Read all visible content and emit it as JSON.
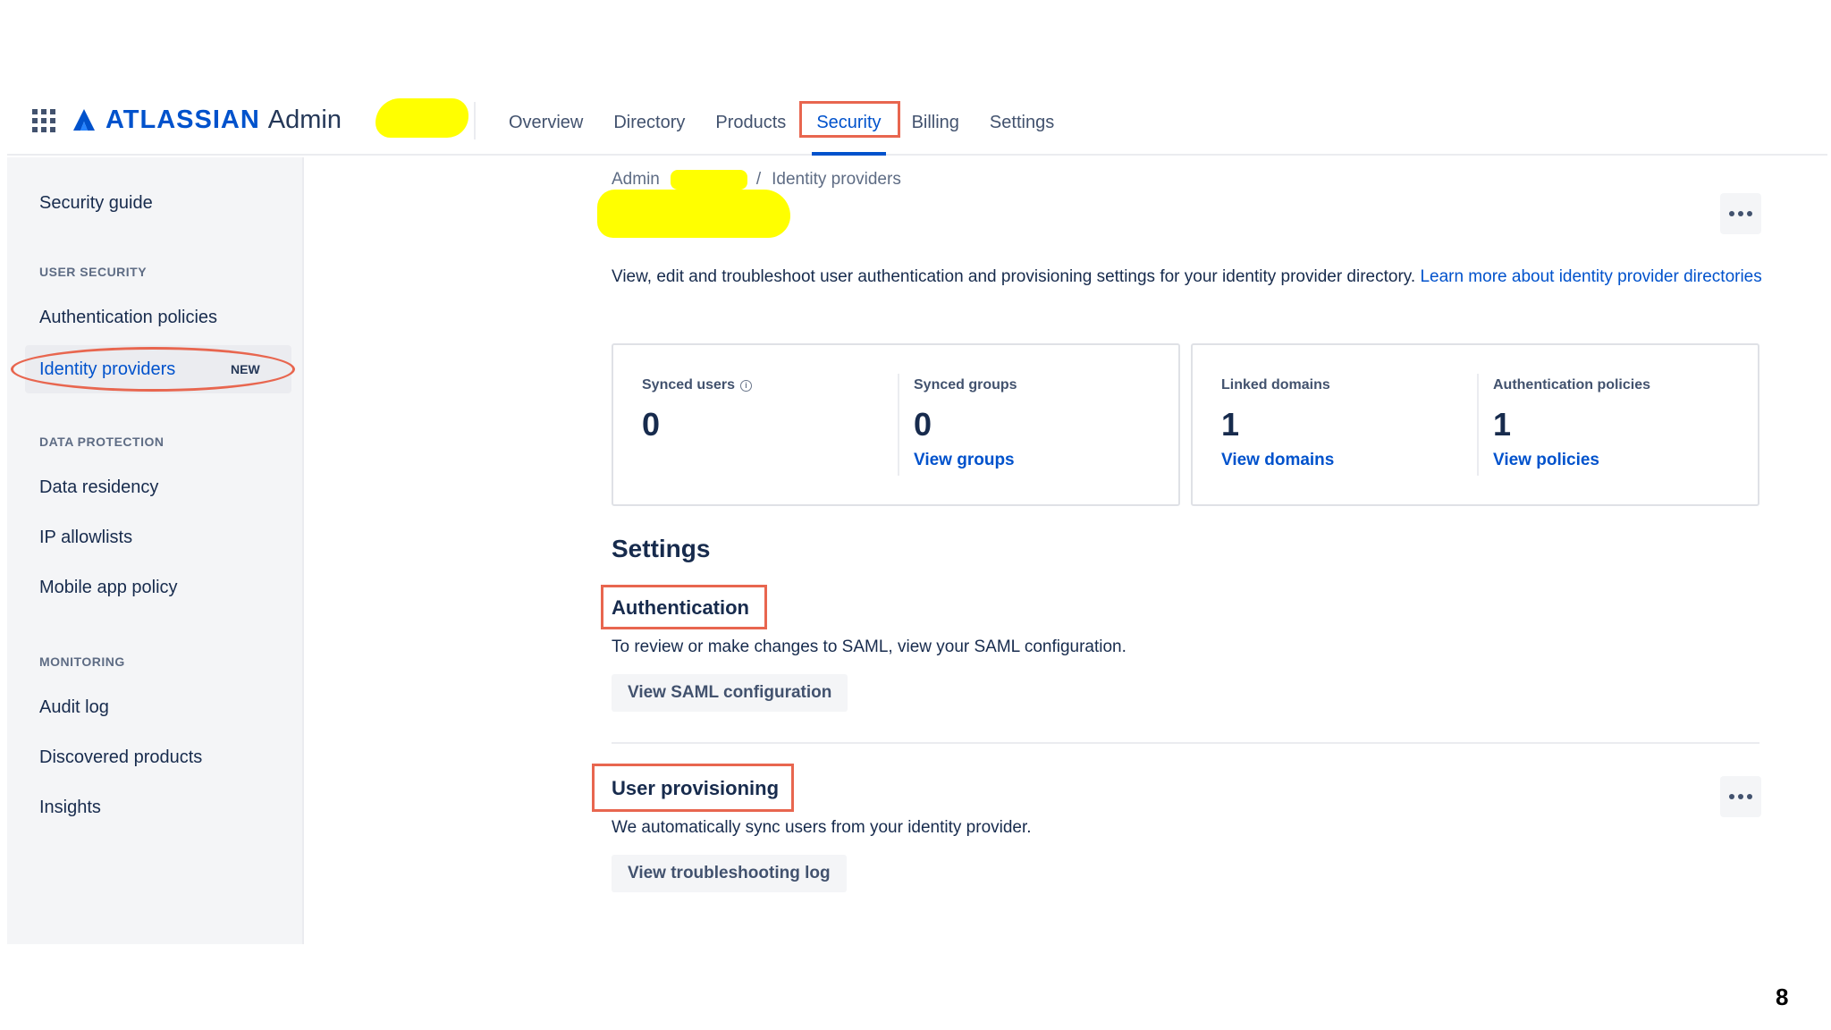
{
  "header": {
    "brand": "ATLASSIAN",
    "product": "Admin",
    "tabs": [
      {
        "label": "Overview"
      },
      {
        "label": "Directory"
      },
      {
        "label": "Products"
      },
      {
        "label": "Security"
      },
      {
        "label": "Billing"
      },
      {
        "label": "Settings"
      }
    ],
    "active_tab": "Security"
  },
  "sidebar": {
    "security_guide": "Security guide",
    "user_security_heading": "USER SECURITY",
    "authentication_policies": "Authentication policies",
    "identity_providers": "Identity providers",
    "new_badge": "NEW",
    "data_protection_heading": "DATA PROTECTION",
    "data_residency": "Data residency",
    "ip_allowlists": "IP allowlists",
    "mobile_app_policy": "Mobile app policy",
    "monitoring_heading": "MONITORING",
    "audit_log": "Audit log",
    "discovered_products": "Discovered products",
    "insights": "Insights"
  },
  "main": {
    "breadcrumb_root": "Admin",
    "breadcrumb_separator": "/",
    "breadcrumb_current": "Identity providers",
    "description": "View, edit and troubleshoot user authentication and provisioning settings for your identity provider directory.",
    "learn_more": "Learn more about identity provider directories",
    "stats": {
      "synced_users_label": "Synced users",
      "synced_users_value": "0",
      "synced_groups_label": "Synced groups",
      "synced_groups_value": "0",
      "view_groups": "View groups",
      "linked_domains_label": "Linked domains",
      "linked_domains_value": "1",
      "view_domains": "View domains",
      "auth_policies_label": "Authentication policies",
      "auth_policies_value": "1",
      "view_policies": "View policies"
    },
    "settings_title": "Settings",
    "authentication": {
      "title": "Authentication",
      "text": "To review or make changes to SAML, view your SAML configuration.",
      "button": "View SAML configuration"
    },
    "provisioning": {
      "title": "User provisioning",
      "text": "We automatically sync users from your identity provider.",
      "button": "View troubleshooting log"
    }
  },
  "slide_number": "8",
  "colors": {
    "accent": "#0052cc",
    "highlight_outline": "#e8664f",
    "redaction": "#ffff00"
  }
}
